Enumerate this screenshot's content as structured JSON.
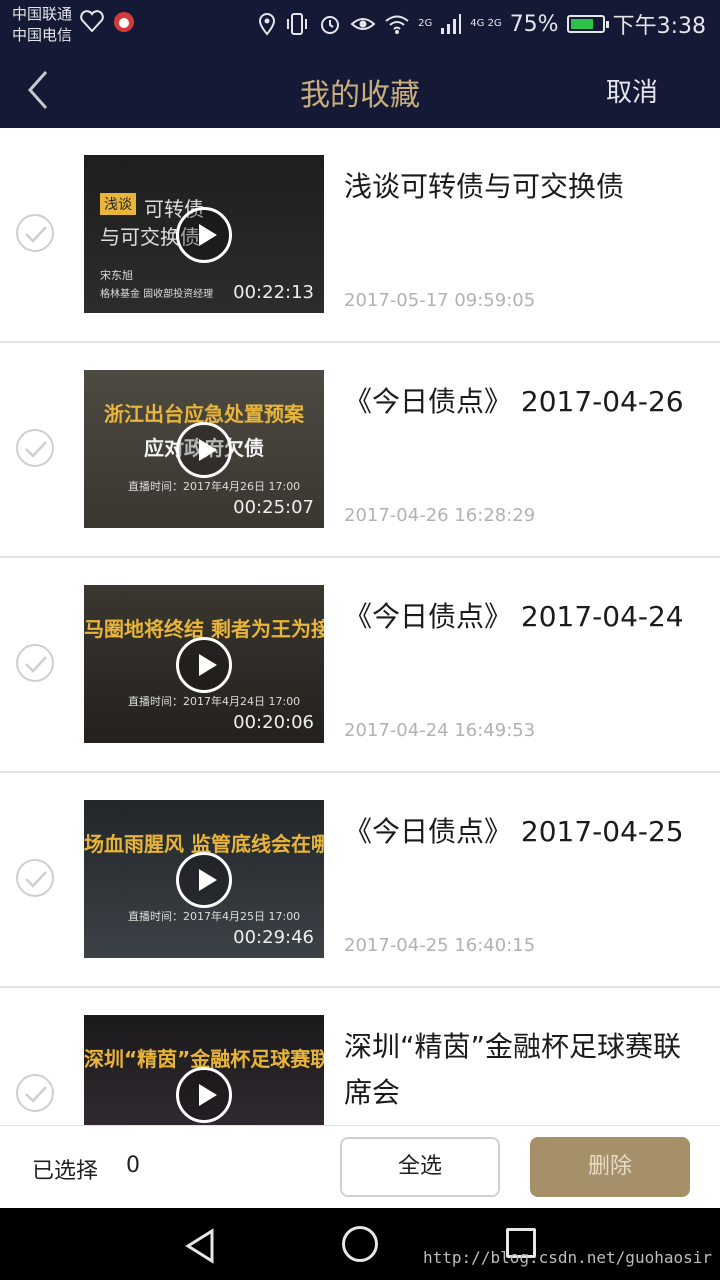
{
  "status_bar": {
    "carrier_1": "中国联通",
    "carrier_2": "中国电信",
    "net_1": "2G",
    "net_2": "4G 2G",
    "battery": "75%",
    "battery_level": 0.75,
    "time": "下午3:38"
  },
  "header": {
    "title": "我的收藏",
    "cancel": "取消"
  },
  "items": [
    {
      "thumb_tag": "浅谈",
      "thumb_line1": "可转债",
      "thumb_line2": "与可交换债",
      "thumb_caption": "宋东旭",
      "thumb_caption2": "格林基金 固收部投资经理",
      "duration": "00:22:13",
      "title": "浅谈可转债与可交换债",
      "date": "2017-05-17 09:59:05",
      "colors": {
        "top": "#1e1e1e",
        "bottom": "#2c2c2c"
      }
    },
    {
      "thumb_line1": "浙江出台应急处置预案",
      "thumb_line2": "应对政府欠债",
      "thumb_caption": "直播时间：2017年4月26日 17:00",
      "duration": "00:25:07",
      "title": "《今日债点》 2017-04-26",
      "date": "2017-04-26 16:28:29",
      "colors": {
        "top": "#4d4a42",
        "bottom": "#3a3630"
      }
    },
    {
      "thumb_line1": "马圈地将终结 剩者为王为接",
      "thumb_line2": "",
      "thumb_caption": "直播时间：2017年4月24日 17:00",
      "duration": "00:20:06",
      "title": "《今日债点》 2017-04-24",
      "date": "2017-04-24 16:49:53",
      "colors": {
        "top": "#3a3630",
        "bottom": "#24211d"
      }
    },
    {
      "thumb_line1": "场血雨腥风 监管底线会在哪",
      "thumb_line2": "",
      "thumb_caption": "直播时间：2017年4月25日 17:00",
      "duration": "00:29:46",
      "title": "《今日债点》 2017-04-25",
      "date": "2017-04-25 16:40:15",
      "colors": {
        "top": "#22262a",
        "bottom": "#3c4247"
      }
    },
    {
      "thumb_line1": "深圳“精茵”金融杯足球赛联席会",
      "thumb_line2": "",
      "thumb_caption": "",
      "duration": "",
      "title": "深圳“精茵”金融杯足球赛联席会",
      "date": "",
      "colors": {
        "top": "#1a1a1a",
        "bottom": "#3b2f3a"
      }
    }
  ],
  "footer": {
    "selected_label": "已选择",
    "selected_count": "0",
    "select_all": "全选",
    "delete": "删除"
  },
  "watermark": "http://blog.csdn.net/guohaosir"
}
